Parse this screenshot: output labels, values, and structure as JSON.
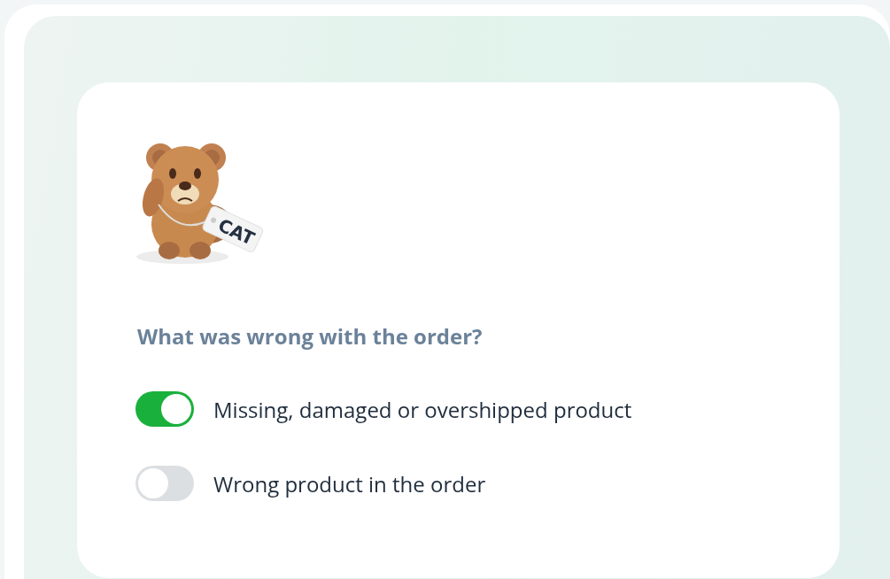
{
  "illustration": {
    "tag_label": "CAT"
  },
  "question": "What was wrong with the order?",
  "options": [
    {
      "label": "Missing, damaged or overshipped product",
      "on": true
    },
    {
      "label": "Wrong product in the order",
      "on": false
    }
  ]
}
